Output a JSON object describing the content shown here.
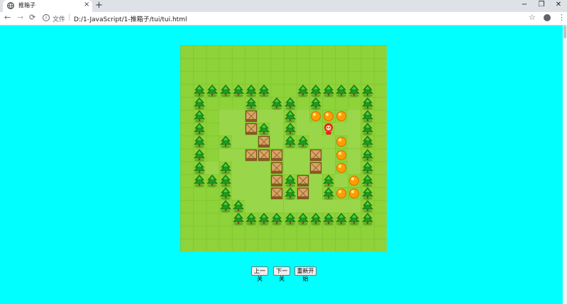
{
  "browser": {
    "tab_title": "推箱子",
    "close_tab": "×",
    "new_tab": "+",
    "window_controls": {
      "minimize": "−",
      "maximize": "❐",
      "close": "✕"
    },
    "nav": {
      "back": "←",
      "forward": "→",
      "reload": "⟳"
    },
    "url_label": "文件",
    "url_separator": "|",
    "url": "D:/1-JavaScript/1-推箱子/tui/tui.html",
    "bookmark_icon": "☆",
    "menu_icon": "⋮",
    "icons": [
      "globe-icon",
      "info-icon",
      "star-icon",
      "account-icon",
      "menu-icon"
    ]
  },
  "page": {
    "background": "#00ffff"
  },
  "game": {
    "columns": 16,
    "rows": 16,
    "legend": {
      "T": "tree",
      "B": "box",
      "G": "goal",
      "P": "player",
      ".": "floor",
      " ": "grass"
    },
    "map": [
      "                ",
      "                ",
      "                ",
      " TTTTTT  TTTTTT ",
      " T   T TT T   T ",
      " T ..B..T.GGG.T ",
      " T ..BT.T..P..T ",
      " T T..B.TT..G.T ",
      " T ..BBB..B.G.T ",
      " T.T...B..B.G.T ",
      " TTT...BTB.T.GT ",
      "   T...BTB.TGGT ",
      "   TT.........T ",
      "    TTTTTTTTTTT ",
      "                ",
      "                "
    ]
  },
  "controls": {
    "prev_level": "上一关",
    "next_level": "下一关",
    "restart": "重新开始"
  }
}
